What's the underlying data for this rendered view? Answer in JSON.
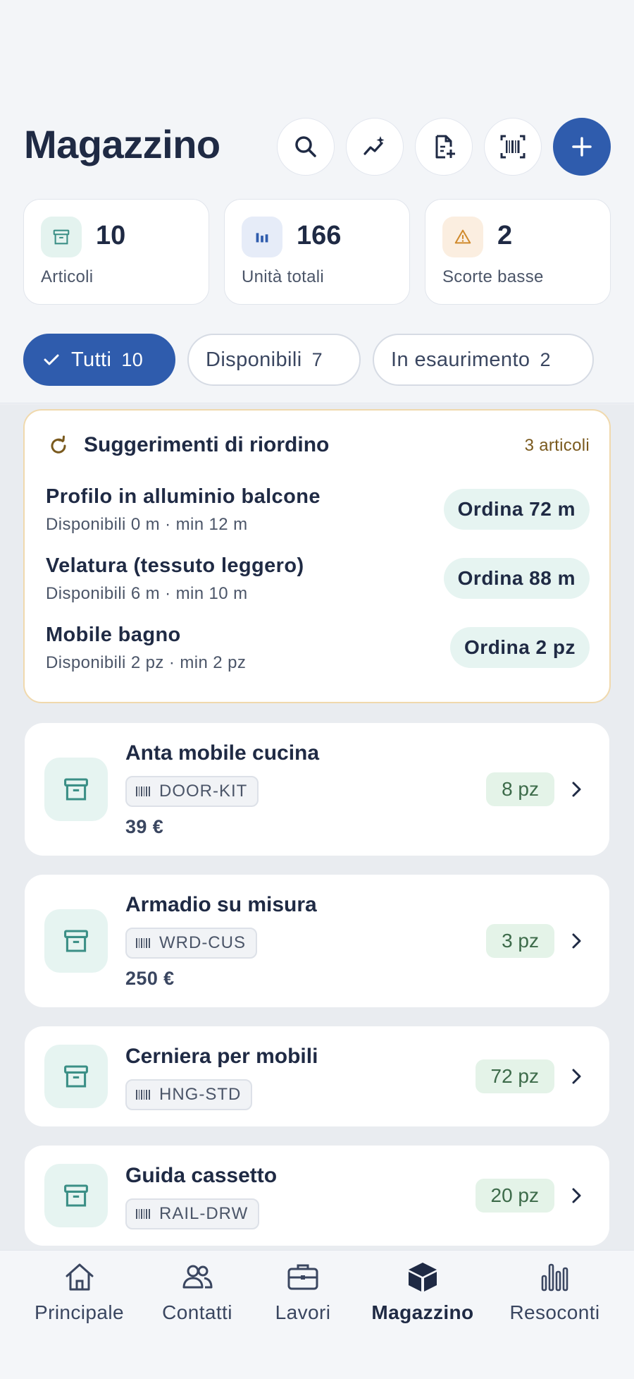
{
  "header": {
    "title": "Magazzino",
    "actions": [
      {
        "name": "search-button",
        "icon": "search-icon"
      },
      {
        "name": "trend-button",
        "icon": "sparkle-trend-icon"
      },
      {
        "name": "add-document-button",
        "icon": "document-plus-icon"
      },
      {
        "name": "scan-barcode-button",
        "icon": "barcode-scan-icon"
      },
      {
        "name": "add-button",
        "icon": "plus-icon"
      }
    ]
  },
  "stats": [
    {
      "value": "10",
      "label": "Articoli",
      "icon": "archive-icon",
      "color": "#e4f3ef"
    },
    {
      "value": "166",
      "label": "Unità totali",
      "icon": "bar-chart-icon",
      "color": "#e6ecf8"
    },
    {
      "value": "2",
      "label": "Scorte basse",
      "icon": "warning-icon",
      "color": "#fbeee0"
    }
  ],
  "filters": [
    {
      "label": "Tutti",
      "count": "10",
      "active": true
    },
    {
      "label": "Disponibili",
      "count": "7",
      "active": false
    },
    {
      "label": "In esaurimento",
      "count": "2",
      "active": false
    }
  ],
  "reorder": {
    "title": "Suggerimenti di riordino",
    "count": "3 articoli",
    "items": [
      {
        "name": "Profilo in alluminio balcone",
        "detail": "Disponibili 0 m · min 12 m",
        "action": "Ordina 72 m"
      },
      {
        "name": "Velatura (tessuto leggero)",
        "detail": "Disponibili 6 m · min 10 m",
        "action": "Ordina 88 m"
      },
      {
        "name": "Mobile bagno",
        "detail": "Disponibili 2 pz · min 2 pz",
        "action": "Ordina 2 pz"
      }
    ]
  },
  "items": [
    {
      "name": "Anta mobile cucina",
      "sku": "DOOR-KIT",
      "price": "39 €",
      "qty": "8 pz"
    },
    {
      "name": "Armadio su misura",
      "sku": "WRD-CUS",
      "price": "250 €",
      "qty": "3 pz"
    },
    {
      "name": "Cerniera per mobili",
      "sku": "HNG-STD",
      "price": "",
      "qty": "72 pz"
    },
    {
      "name": "Guida cassetto",
      "sku": "RAIL-DRW",
      "price": "",
      "qty": "20 pz"
    }
  ],
  "tabs": [
    {
      "label": "Principale",
      "icon": "home-icon",
      "active": false
    },
    {
      "label": "Contatti",
      "icon": "contacts-icon",
      "active": false
    },
    {
      "label": "Lavori",
      "icon": "briefcase-icon",
      "active": false
    },
    {
      "label": "Magazzino",
      "icon": "box-icon",
      "active": true
    },
    {
      "label": "Resoconti",
      "icon": "bar-chart-icon",
      "active": false
    }
  ],
  "colors": {
    "accent": "#2f5cad",
    "teal": "#3b8f86",
    "warning": "#d08a2c"
  }
}
